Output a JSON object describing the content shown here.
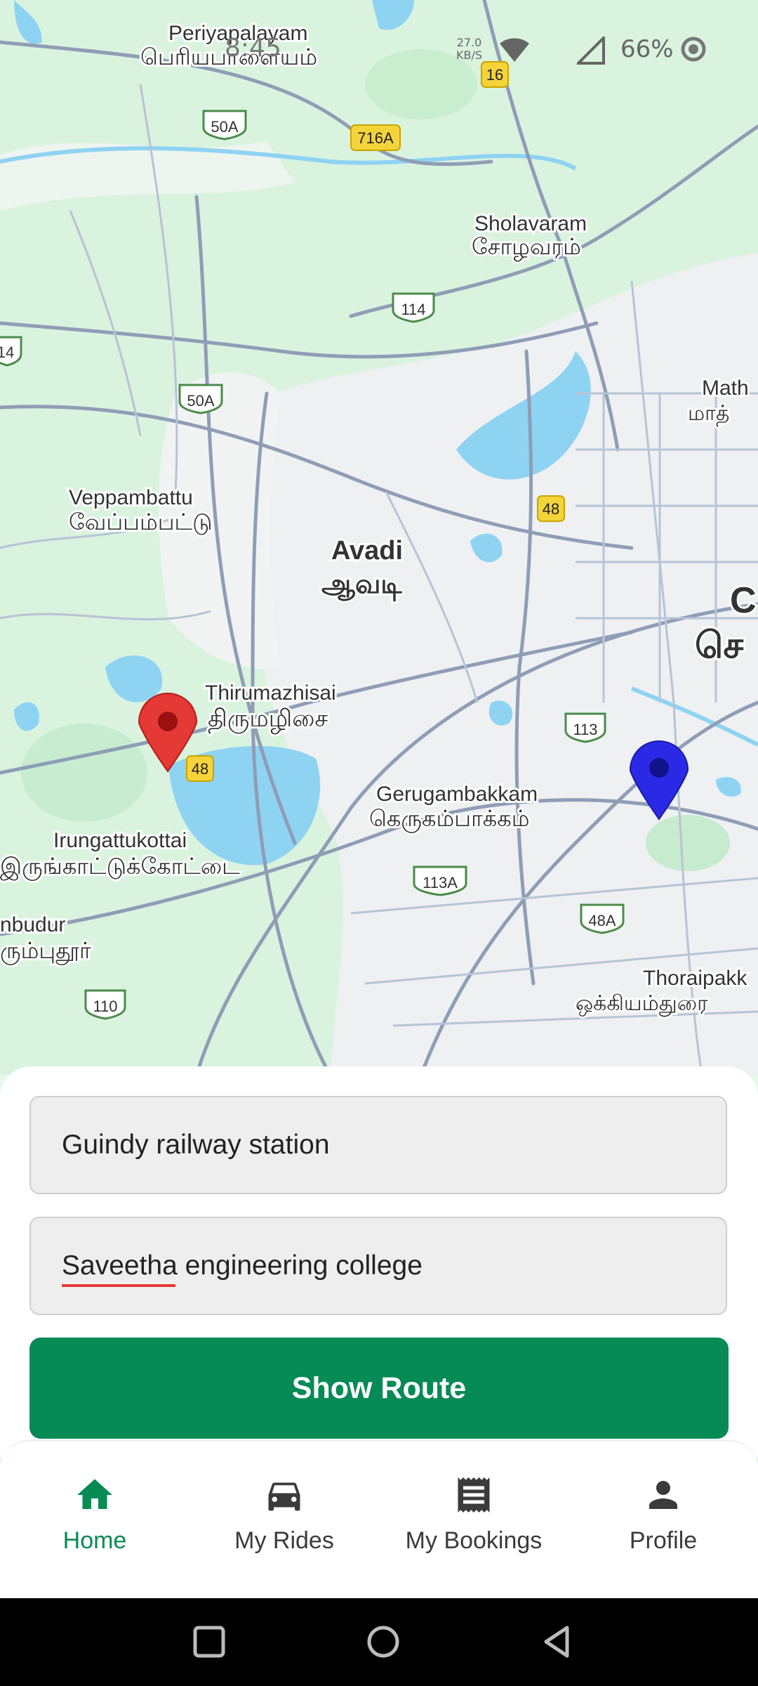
{
  "status_bar": {
    "time": "8:45",
    "net_speed_value": "27.0",
    "net_speed_unit": "KB/S",
    "battery": "66%"
  },
  "map": {
    "labels": [
      {
        "id": "periyapalayam",
        "en": "Periyapalayam",
        "ta": "பெரியபாளையம்"
      },
      {
        "id": "sholavaram",
        "en": "Sholavaram",
        "ta": "சோழவரம்"
      },
      {
        "id": "veppambattu",
        "en": "Veppambattu",
        "ta": "வேப்பம்பட்டு"
      },
      {
        "id": "avadi",
        "en": "Avadi",
        "ta": "ஆவடி"
      },
      {
        "id": "thirumazhisai",
        "en": "Thirumazhisai",
        "ta": "திருமழிசை"
      },
      {
        "id": "gerugambakkam",
        "en": "Gerugambakkam",
        "ta": "கெருகம்பாக்கம்"
      },
      {
        "id": "irungattukottai",
        "en": "Irungattukottai",
        "ta": "இருங்காட்டுக்கோட்டை"
      },
      {
        "id": "thoraipakkam",
        "en": "Thoraipakk",
        "ta": "ஒக்கியம்துரை"
      },
      {
        "id": "mathur",
        "en": "Math",
        "ta": "மாத்"
      },
      {
        "id": "sriperumbudur",
        "en": "nbudur",
        "ta": "ரும்புதூர்"
      },
      {
        "id": "chennai",
        "en": "C",
        "ta": "செ"
      }
    ],
    "road_badges": [
      {
        "id": "16",
        "text": "16",
        "kind": "state"
      },
      {
        "id": "50a-top",
        "text": "50A",
        "kind": "national"
      },
      {
        "id": "716a",
        "text": "716A",
        "kind": "state"
      },
      {
        "id": "114",
        "text": "114",
        "kind": "national"
      },
      {
        "id": "14",
        "text": "14",
        "kind": "national"
      },
      {
        "id": "50a-mid",
        "text": "50A",
        "kind": "national"
      },
      {
        "id": "48-top",
        "text": "48",
        "kind": "state"
      },
      {
        "id": "113",
        "text": "113",
        "kind": "national"
      },
      {
        "id": "48-bot",
        "text": "48",
        "kind": "state"
      },
      {
        "id": "113a",
        "text": "113A",
        "kind": "national"
      },
      {
        "id": "48a",
        "text": "48A",
        "kind": "national"
      },
      {
        "id": "110",
        "text": "110",
        "kind": "national"
      }
    ],
    "markers": [
      {
        "id": "destination-marker",
        "color": "#e53935"
      },
      {
        "id": "source-marker",
        "color": "#2a2ae6"
      }
    ]
  },
  "form": {
    "source_value": "Guindy railway station",
    "destination_value": "Saveetha engineering college",
    "show_route_label": "Show Route"
  },
  "nav": {
    "items": [
      {
        "label": "Home",
        "icon": "home-icon",
        "active": true
      },
      {
        "label": "My Rides",
        "icon": "car-icon",
        "active": false
      },
      {
        "label": "My Bookings",
        "icon": "receipt-icon",
        "active": false
      },
      {
        "label": "Profile",
        "icon": "person-icon",
        "active": false
      }
    ]
  },
  "colors": {
    "accent": "#068a56",
    "map_green": "#d5f0dc",
    "water": "#8fd3f3",
    "road": "#8f9db6"
  }
}
